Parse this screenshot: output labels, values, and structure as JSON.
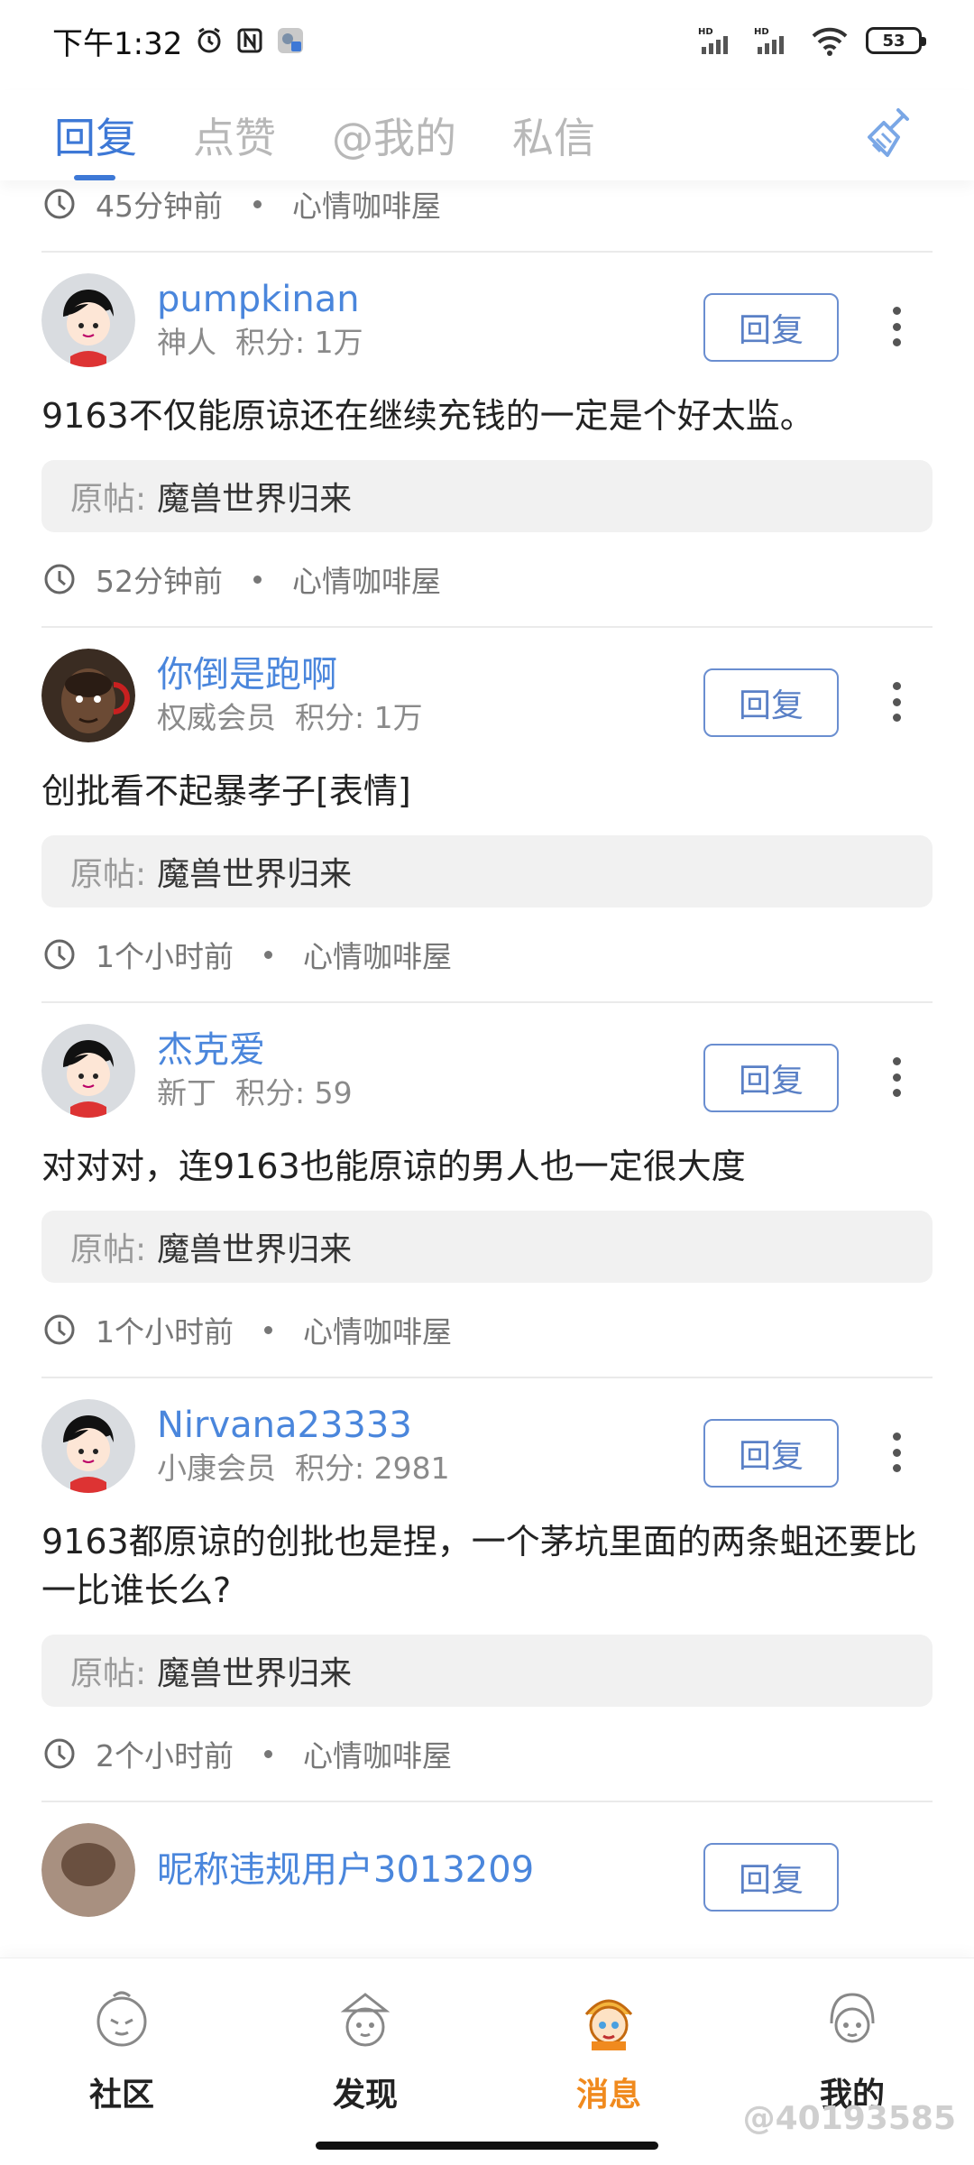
{
  "status_bar": {
    "time": "下午1:32",
    "battery": "53",
    "network1": "HD",
    "network2": "HD"
  },
  "tabs": [
    {
      "label": "回复",
      "active": true
    },
    {
      "label": "点赞",
      "active": false
    },
    {
      "label": "@我的",
      "active": false
    },
    {
      "label": "私信",
      "active": false
    }
  ],
  "top_meta": {
    "time": "45分钟前",
    "forum": "心情咖啡屋"
  },
  "items": [
    {
      "username": "pumpkinan",
      "level": "神人",
      "points": "积分: 1万",
      "reply_label": "回复",
      "content": "9163不仅能原谅还在继续充钱的一定是个好太监。",
      "origin_label": "原帖:",
      "origin_title": "魔兽世界归来",
      "time": "52分钟前",
      "forum": "心情咖啡屋"
    },
    {
      "username": "你倒是跑啊",
      "level": "权威会员",
      "points": "积分: 1万",
      "reply_label": "回复",
      "content": "创批看不起暴孝子[表情]",
      "origin_label": "原帖:",
      "origin_title": "魔兽世界归来",
      "time": "1个小时前",
      "forum": "心情咖啡屋"
    },
    {
      "username": "杰克爱",
      "level": "新丁",
      "points": "积分: 59",
      "reply_label": "回复",
      "content": "对对对，连9163也能原谅的男人也一定很大度",
      "origin_label": "原帖:",
      "origin_title": "魔兽世界归来",
      "time": "1个小时前",
      "forum": "心情咖啡屋"
    },
    {
      "username": "Nirvana23333",
      "level": "小康会员",
      "points": "积分: 2981",
      "reply_label": "回复",
      "content": "9163都原谅的创批也是捏，一个茅坑里面的两条蛆还要比一比谁长么?",
      "origin_label": "原帖:",
      "origin_title": "魔兽世界归来",
      "time": "2个小时前",
      "forum": "心情咖啡屋"
    },
    {
      "username": "昵称违规用户3013209",
      "reply_label": "回复"
    }
  ],
  "bottom_nav": [
    {
      "label": "社区",
      "icon": "community-icon",
      "active": false
    },
    {
      "label": "发现",
      "icon": "discover-icon",
      "active": false
    },
    {
      "label": "消息",
      "icon": "message-icon",
      "active": true
    },
    {
      "label": "我的",
      "icon": "profile-icon",
      "active": false
    }
  ],
  "watermark": "@40193585",
  "colors": {
    "accent": "#3d78d6",
    "username": "#4a86dc",
    "nav_active": "#f08a1e"
  }
}
